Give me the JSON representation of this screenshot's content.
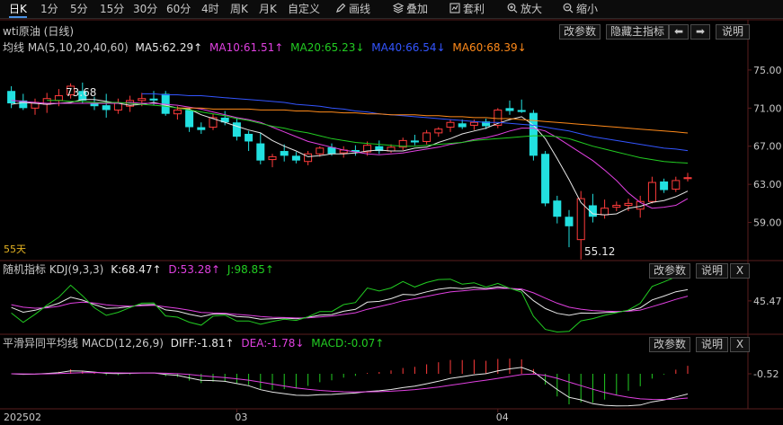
{
  "toolbar": {
    "items": [
      "日K",
      "1分",
      "5分",
      "15分",
      "30分",
      "60分",
      "4时",
      "周K",
      "月K",
      "自定义"
    ],
    "draw_label": "画线",
    "overlay_label": "叠加",
    "arbitrage_label": "套利",
    "zoom_in_label": "放大",
    "zoom_out_label": "缩小"
  },
  "main": {
    "title": "wti原油 (日线)",
    "buttons": {
      "params": "改参数",
      "hide": "隐藏主指标",
      "help": "说明"
    },
    "ma_label": "均线 MA(5,10,20,40,60)",
    "ma_values": [
      {
        "label": "MA5:62.29↑",
        "color": "#e8e8e8"
      },
      {
        "label": "MA10:61.51↑",
        "color": "#e040e0"
      },
      {
        "label": "MA20:65.23↓",
        "color": "#22cc22"
      },
      {
        "label": "MA40:66.54↓",
        "color": "#3355ff"
      },
      {
        "label": "MA60:68.39↓",
        "color": "#ff8a1a"
      }
    ],
    "high_label": "73.68",
    "low_label": "55.12",
    "period_label": "55天"
  },
  "kdj": {
    "label": "随机指标 KDJ(9,3,3)",
    "values": [
      {
        "label": "K:68.47↑",
        "color": "#e8e8e8"
      },
      {
        "label": "D:53.28↑",
        "color": "#e040e0"
      },
      {
        "label": "J:98.85↑",
        "color": "#22cc22"
      }
    ],
    "buttons": {
      "params": "改参数",
      "help": "说明",
      "close": "X"
    }
  },
  "macd": {
    "label": "平滑异同平均线 MACD(12,26,9)",
    "values": [
      {
        "label": "DIFF:-1.81↑",
        "color": "#e8e8e8"
      },
      {
        "label": "DEA:-1.78↓",
        "color": "#e040e0"
      },
      {
        "label": "MACD:-0.07↑",
        "color": "#22cc22"
      }
    ],
    "buttons": {
      "params": "改参数",
      "help": "说明",
      "close": "X"
    }
  },
  "x_axis": [
    "202502",
    "03",
    "04"
  ],
  "colors": {
    "up": "#ff3b3b",
    "down": "#22e0e0",
    "bg": "#000000",
    "grid": "#5a1e1e"
  },
  "chart_data": {
    "type": "candlestick",
    "y_ticks": [
      75.0,
      71.0,
      67.0,
      63.0,
      59.0
    ],
    "ylim": [
      55.0,
      76.5
    ],
    "kdj_y_ticks": [
      45.47
    ],
    "macd_y_ticks": [
      -0.52
    ],
    "candles": [
      {
        "o": 72.8,
        "h": 73.3,
        "l": 71.0,
        "c": 71.5
      },
      {
        "o": 71.8,
        "h": 72.5,
        "l": 70.8,
        "c": 71.0
      },
      {
        "o": 71.0,
        "h": 72.0,
        "l": 70.3,
        "c": 71.6
      },
      {
        "o": 71.4,
        "h": 72.6,
        "l": 70.5,
        "c": 72.0
      },
      {
        "o": 71.8,
        "h": 73.0,
        "l": 71.2,
        "c": 72.3
      },
      {
        "o": 72.4,
        "h": 73.6,
        "l": 72.0,
        "c": 73.3
      },
      {
        "o": 72.8,
        "h": 73.68,
        "l": 71.5,
        "c": 71.8
      },
      {
        "o": 71.5,
        "h": 72.2,
        "l": 70.8,
        "c": 71.2
      },
      {
        "o": 71.3,
        "h": 72.5,
        "l": 70.0,
        "c": 70.8
      },
      {
        "o": 70.8,
        "h": 72.0,
        "l": 70.4,
        "c": 71.5
      },
      {
        "o": 71.2,
        "h": 72.3,
        "l": 70.6,
        "c": 71.8
      },
      {
        "o": 71.8,
        "h": 72.6,
        "l": 71.2,
        "c": 72.0
      },
      {
        "o": 72.0,
        "h": 72.8,
        "l": 71.3,
        "c": 71.8
      },
      {
        "o": 72.5,
        "h": 72.8,
        "l": 70.2,
        "c": 70.4
      },
      {
        "o": 70.4,
        "h": 71.2,
        "l": 69.8,
        "c": 70.8
      },
      {
        "o": 70.8,
        "h": 71.0,
        "l": 68.5,
        "c": 69.0
      },
      {
        "o": 69.0,
        "h": 69.5,
        "l": 68.3,
        "c": 68.7
      },
      {
        "o": 69.0,
        "h": 70.4,
        "l": 68.7,
        "c": 70.0
      },
      {
        "o": 70.0,
        "h": 70.7,
        "l": 69.2,
        "c": 69.5
      },
      {
        "o": 69.5,
        "h": 70.0,
        "l": 67.6,
        "c": 68.0
      },
      {
        "o": 68.3,
        "h": 68.6,
        "l": 66.5,
        "c": 67.5
      },
      {
        "o": 67.3,
        "h": 68.4,
        "l": 65.1,
        "c": 65.5
      },
      {
        "o": 65.6,
        "h": 66.2,
        "l": 64.8,
        "c": 65.9
      },
      {
        "o": 66.5,
        "h": 67.2,
        "l": 65.4,
        "c": 66.0
      },
      {
        "o": 66.0,
        "h": 66.4,
        "l": 65.2,
        "c": 65.5
      },
      {
        "o": 65.4,
        "h": 66.5,
        "l": 65.0,
        "c": 66.2
      },
      {
        "o": 66.2,
        "h": 67.0,
        "l": 65.9,
        "c": 66.8
      },
      {
        "o": 66.9,
        "h": 67.3,
        "l": 66.0,
        "c": 66.2
      },
      {
        "o": 66.3,
        "h": 67.0,
        "l": 65.8,
        "c": 66.6
      },
      {
        "o": 66.6,
        "h": 67.1,
        "l": 66.0,
        "c": 66.4
      },
      {
        "o": 66.4,
        "h": 67.5,
        "l": 66.0,
        "c": 67.1
      },
      {
        "o": 67.0,
        "h": 67.6,
        "l": 66.2,
        "c": 66.5
      },
      {
        "o": 66.5,
        "h": 67.2,
        "l": 66.3,
        "c": 66.9
      },
      {
        "o": 66.9,
        "h": 67.9,
        "l": 66.6,
        "c": 67.6
      },
      {
        "o": 67.6,
        "h": 68.2,
        "l": 67.1,
        "c": 67.4
      },
      {
        "o": 67.5,
        "h": 68.7,
        "l": 67.2,
        "c": 68.4
      },
      {
        "o": 68.4,
        "h": 69.0,
        "l": 68.0,
        "c": 68.8
      },
      {
        "o": 69.0,
        "h": 69.8,
        "l": 68.5,
        "c": 69.5
      },
      {
        "o": 69.4,
        "h": 69.8,
        "l": 68.8,
        "c": 69.0
      },
      {
        "o": 69.2,
        "h": 69.8,
        "l": 68.7,
        "c": 69.5
      },
      {
        "o": 69.6,
        "h": 69.9,
        "l": 68.8,
        "c": 69.1
      },
      {
        "o": 69.2,
        "h": 71.0,
        "l": 68.9,
        "c": 70.8
      },
      {
        "o": 71.0,
        "h": 71.8,
        "l": 70.3,
        "c": 70.7
      },
      {
        "o": 70.8,
        "h": 71.9,
        "l": 70.5,
        "c": 70.6
      },
      {
        "o": 70.5,
        "h": 70.8,
        "l": 65.5,
        "c": 66.0
      },
      {
        "o": 66.2,
        "h": 66.5,
        "l": 60.7,
        "c": 61.0
      },
      {
        "o": 61.3,
        "h": 61.8,
        "l": 58.9,
        "c": 59.6
      },
      {
        "o": 59.6,
        "h": 60.3,
        "l": 56.4,
        "c": 58.6
      },
      {
        "o": 57.2,
        "h": 62.3,
        "l": 55.12,
        "c": 61.5
      },
      {
        "o": 60.8,
        "h": 62.0,
        "l": 59.0,
        "c": 59.6
      },
      {
        "o": 59.8,
        "h": 61.4,
        "l": 59.4,
        "c": 60.5
      },
      {
        "o": 60.6,
        "h": 61.2,
        "l": 60.2,
        "c": 60.8
      },
      {
        "o": 60.8,
        "h": 61.5,
        "l": 60.2,
        "c": 61.0
      },
      {
        "o": 60.4,
        "h": 61.8,
        "l": 59.5,
        "c": 61.2
      },
      {
        "o": 61.2,
        "h": 63.8,
        "l": 61.0,
        "c": 63.2
      },
      {
        "o": 63.3,
        "h": 63.6,
        "l": 62.1,
        "c": 62.4
      },
      {
        "o": 62.5,
        "h": 63.8,
        "l": 62.2,
        "c": 63.4
      },
      {
        "o": 63.6,
        "h": 64.2,
        "l": 63.3,
        "c": 63.7
      }
    ],
    "series": [
      {
        "name": "MA5",
        "values": [
          71.4,
          71.6,
          71.5,
          71.4,
          71.5,
          71.6,
          71.9,
          71.9,
          71.7,
          71.5,
          71.3,
          71.4,
          71.6,
          71.3,
          71.0,
          70.9,
          70.3,
          69.9,
          69.5,
          69.1,
          68.7,
          68.4,
          67.6,
          67.0,
          66.5,
          65.9,
          66.0,
          66.2,
          66.2,
          66.3,
          66.5,
          66.6,
          66.5,
          66.5,
          66.8,
          66.9,
          67.4,
          67.8,
          68.3,
          68.6,
          68.9,
          69.4,
          69.8,
          70.1,
          69.2,
          67.8,
          65.7,
          63.5,
          61.1,
          59.9,
          59.8,
          59.9,
          60.5,
          60.7,
          61.1,
          61.3,
          61.7,
          62.29
        ]
      },
      {
        "name": "MA10",
        "values": [
          71.8,
          71.7,
          71.6,
          71.5,
          71.5,
          71.5,
          71.5,
          71.5,
          71.5,
          71.5,
          71.6,
          71.5,
          71.5,
          71.4,
          71.3,
          71.1,
          70.9,
          70.6,
          70.3,
          70.0,
          69.8,
          69.5,
          69.0,
          68.5,
          68.0,
          67.5,
          67.2,
          66.9,
          66.6,
          66.4,
          66.2,
          66.1,
          66.2,
          66.3,
          66.5,
          66.7,
          66.9,
          67.2,
          67.4,
          67.7,
          67.9,
          68.2,
          68.6,
          68.9,
          68.9,
          68.6,
          67.9,
          67.1,
          66.3,
          65.5,
          64.5,
          63.4,
          62.1,
          61.1,
          60.5,
          60.6,
          60.8,
          61.51
        ]
      },
      {
        "name": "MA20",
        "values": [
          71.8,
          71.8,
          71.7,
          71.7,
          71.6,
          71.6,
          71.6,
          71.5,
          71.4,
          71.3,
          71.2,
          71.0,
          70.8,
          70.6,
          70.4,
          70.2,
          69.9,
          69.7,
          69.4,
          69.1,
          68.9,
          68.6,
          68.4,
          68.1,
          67.8,
          67.6,
          67.4,
          67.3,
          67.2,
          67.1,
          67.0,
          67.0,
          67.1,
          67.2,
          67.3,
          67.4,
          67.6,
          67.7,
          67.8,
          67.9,
          68.0,
          68.1,
          68.1,
          68.0,
          67.8,
          67.4,
          67.0,
          66.7,
          66.4,
          66.1,
          65.8,
          65.6,
          65.4,
          65.3,
          65.23
        ]
      },
      {
        "name": "MA40",
        "values": [
          72.5,
          72.5,
          72.4,
          72.4,
          72.3,
          72.3,
          72.2,
          72.1,
          72.0,
          71.9,
          71.8,
          71.7,
          71.6,
          71.4,
          71.3,
          71.2,
          71.0,
          70.9,
          70.7,
          70.6,
          70.4,
          70.3,
          70.2,
          70.1,
          70.0,
          69.9,
          69.8,
          69.7,
          69.6,
          69.5,
          69.5,
          69.4,
          69.3,
          69.2,
          69.0,
          68.8,
          68.6,
          68.3,
          68.0,
          67.8,
          67.6,
          67.4,
          67.2,
          67.0,
          66.8,
          66.7,
          66.54
        ]
      },
      {
        "name": "MA60",
        "values": [
          71.0,
          71.0,
          71.0,
          70.9,
          70.9,
          70.9,
          70.9,
          70.8,
          70.8,
          70.8,
          70.7,
          70.7,
          70.6,
          70.6,
          70.5,
          70.5,
          70.4,
          70.4,
          70.3,
          70.3,
          70.3,
          70.2,
          70.2,
          70.1,
          70.1,
          70.0,
          70.0,
          69.9,
          69.9,
          69.8,
          69.7,
          69.6,
          69.5,
          69.4,
          69.3,
          69.2,
          69.1,
          69.0,
          68.9,
          68.8,
          68.7,
          68.6,
          68.5,
          68.39
        ]
      }
    ]
  }
}
